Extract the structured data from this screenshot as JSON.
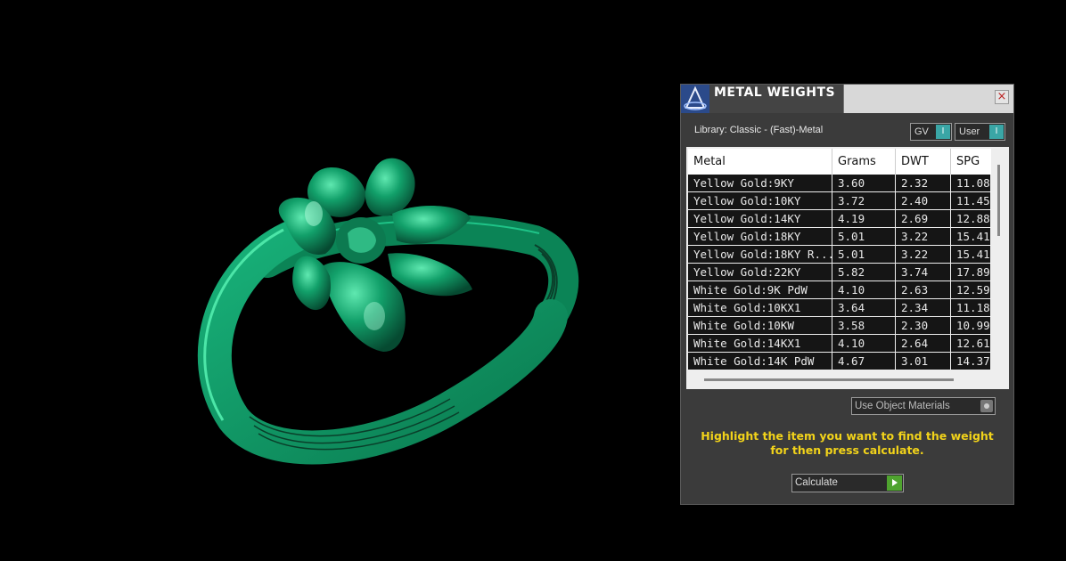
{
  "panel": {
    "title": "METAL WEIGHTS",
    "close_glyph": "×",
    "library_label": "Library: Classic - (Fast)-Metal",
    "toggles": [
      {
        "label": "GV",
        "knob": "I"
      },
      {
        "label": "User",
        "knob": "I"
      }
    ],
    "table": {
      "columns": [
        "Metal",
        "Grams",
        "DWT",
        "SPG"
      ],
      "rows": [
        [
          "Yellow Gold:9KY",
          "3.60",
          "2.32",
          "11.08"
        ],
        [
          "Yellow Gold:10KY",
          "3.72",
          "2.40",
          "11.45"
        ],
        [
          "Yellow Gold:14KY",
          "4.19",
          "2.69",
          "12.88"
        ],
        [
          "Yellow Gold:18KY",
          "5.01",
          "3.22",
          "15.41"
        ],
        [
          "Yellow Gold:18KY R...",
          "5.01",
          "3.22",
          "15.41"
        ],
        [
          "Yellow Gold:22KY",
          "5.82",
          "3.74",
          "17.89"
        ],
        [
          "White Gold:9K PdW",
          "4.10",
          "2.63",
          "12.59"
        ],
        [
          "White Gold:10KX1",
          "3.64",
          "2.34",
          "11.18"
        ],
        [
          "White Gold:10KW",
          "3.58",
          "2.30",
          "10.99"
        ],
        [
          "White Gold:14KX1",
          "4.10",
          "2.64",
          "12.61"
        ],
        [
          "White Gold:14K PdW",
          "4.67",
          "3.01",
          "14.37"
        ]
      ]
    },
    "use_materials_label": "Use Object Materials",
    "instruction_line1": "Highlight the item you want to find the weight",
    "instruction_line2": "for then press calculate.",
    "calculate_label": "Calculate"
  },
  "colors": {
    "ring": "#0f8f5e",
    "ring_highlight": "#3fd69a",
    "instruction": "#f2d31a",
    "toggle_accent": "#3aa6a6",
    "calc_accent": "#4fa32f"
  },
  "icons": [
    "app-logo-icon",
    "close-icon",
    "material-picker-icon",
    "play-icon"
  ]
}
